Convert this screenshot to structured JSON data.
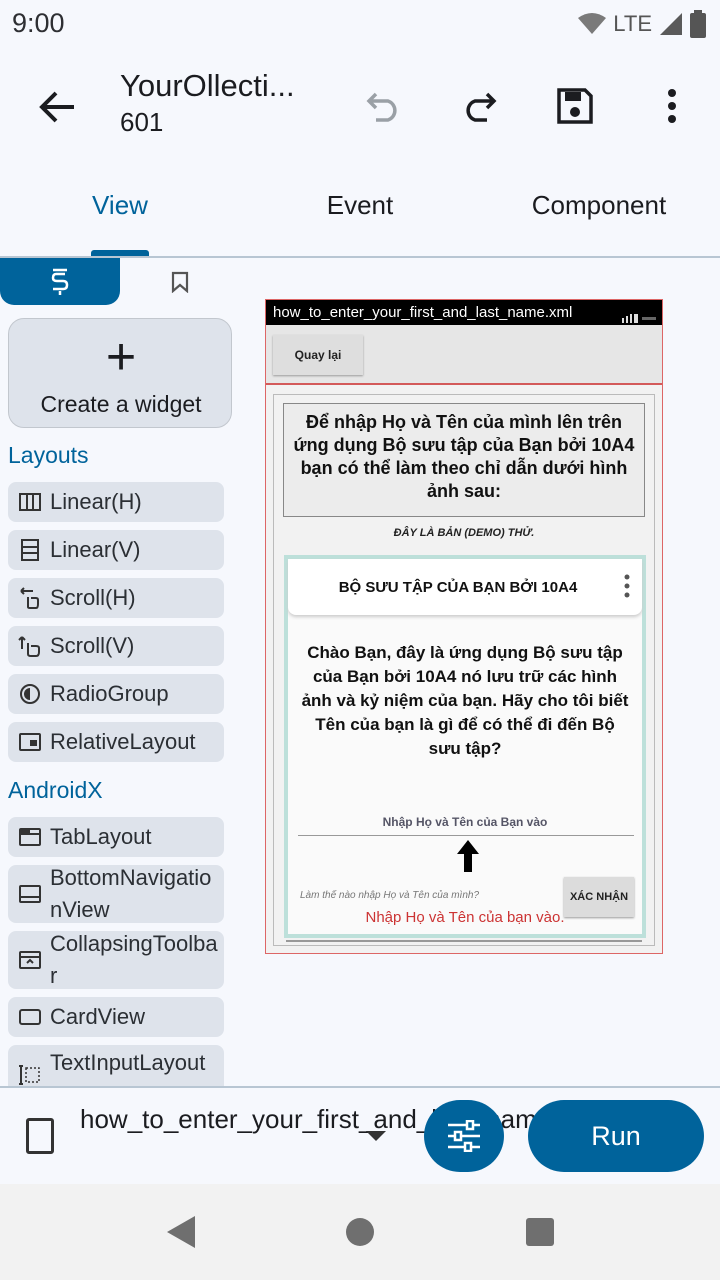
{
  "status_bar": {
    "time": "9:00",
    "network": "LTE"
  },
  "toolbar": {
    "title": "YourOllecti...",
    "subtitle": "601"
  },
  "tabs": [
    {
      "label": "View",
      "selected": true
    },
    {
      "label": "Event",
      "selected": false
    },
    {
      "label": "Component",
      "selected": false
    }
  ],
  "colors": {
    "accent": "#00639b",
    "chip_bg": "#dee3eb",
    "preview_error_red": "#c33333"
  },
  "sidebar": {
    "create_widget_label": "Create a widget",
    "sections": [
      {
        "title": "Layouts",
        "items": [
          {
            "label": "Linear(H)",
            "icon": "linear-horizontal-icon"
          },
          {
            "label": "Linear(V)",
            "icon": "linear-vertical-icon"
          },
          {
            "label": "Scroll(H)",
            "icon": "scroll-horizontal-icon"
          },
          {
            "label": "Scroll(V)",
            "icon": "scroll-vertical-icon"
          },
          {
            "label": "RadioGroup",
            "icon": "radio-group-icon"
          },
          {
            "label": "RelativeLayout",
            "icon": "relative-layout-icon"
          }
        ]
      },
      {
        "title": "AndroidX",
        "items": [
          {
            "label": "TabLayout",
            "icon": "tab-layout-icon"
          },
          {
            "label": "BottomNavigationView",
            "icon": "bottom-navigation-icon"
          },
          {
            "label": "CollapsingToolbar",
            "icon": "collapsing-toolbar-icon"
          },
          {
            "label": "CardView",
            "icon": "card-view-icon"
          },
          {
            "label": "TextInputLayout",
            "icon": "text-input-layout-icon"
          }
        ]
      }
    ]
  },
  "preview": {
    "file_title": "how_to_enter_your_first_and_last_name.xml",
    "back_button": "Quay lại",
    "instruction": "Để nhập Họ và Tên của mình lên trên ứng dụng Bộ sưu tập của Bạn bởi 10A4 bạn có thể làm theo chỉ dẫn dưới hình ảnh sau:",
    "demo_note": "ĐÂY LÀ BẢN (DEMO) THỬ.",
    "screenshot": {
      "title": "BỘ SƯU TẬP CỦA BẠN BỞI 10A4",
      "message": "Chào Bạn, đây là ứng dụng Bộ sưu tập của Bạn bởi 10A4 nó lưu trữ các hình ảnh và kỷ niệm của bạn. Hãy cho tôi biết Tên của bạn là gì để có thể đi đến Bộ sưu tập?",
      "input_hint": "Nhập Họ và Tên của Bạn vào",
      "help_text": "Làm thế nào nhập Họ và Tên của mình?",
      "confirm_button": "XÁC NHẬN",
      "red_note": "Nhập Họ và Tên của bạn vào."
    }
  },
  "bottom_bar": {
    "file_name": "how_to_enter_your_first_and_last_name.xml",
    "run_label": "Run"
  }
}
